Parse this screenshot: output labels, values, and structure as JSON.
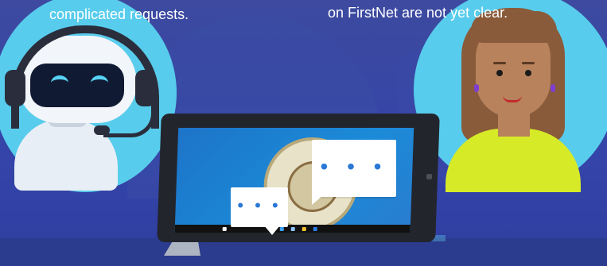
{
  "captions": {
    "left": "complicated requests.",
    "right": "on FirstNet are not yet clear."
  },
  "illustration": {
    "robot": {
      "icon": "chatbot-robot-icon"
    },
    "person": {
      "icon": "woman-avatar-icon"
    },
    "device": {
      "icon": "tablet-icon",
      "screen_emblem": "city-seal-icon"
    },
    "bubbles": [
      {
        "icon": "typing-indicator-icon",
        "dots": "• • •"
      },
      {
        "icon": "typing-indicator-icon",
        "dots": "• • •"
      }
    ]
  },
  "colors": {
    "background": "#3444a8",
    "circle": "#58ccec",
    "screen": "#1b8bd8",
    "shirt": "#d7ea28"
  }
}
